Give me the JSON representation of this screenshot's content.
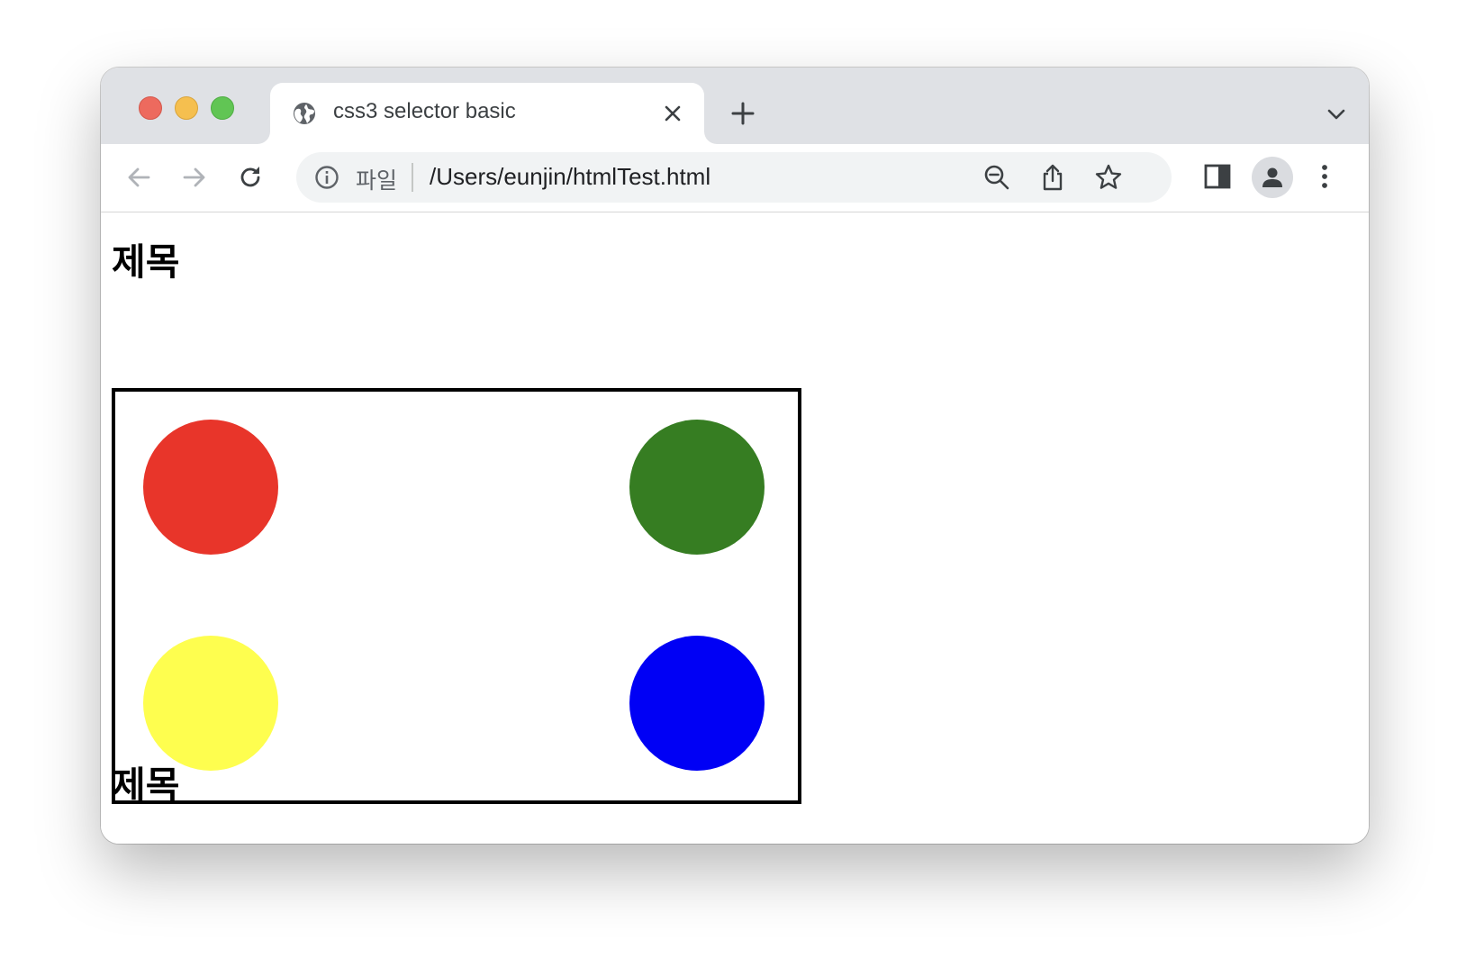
{
  "tab": {
    "title": "css3 selector basic"
  },
  "omnibox": {
    "scheme_label": "파일",
    "url": "/Users/eunjin/htmlTest.html"
  },
  "page": {
    "heading_top": "제목",
    "heading_bottom": "제목",
    "circles": [
      {
        "color": "#e8352a"
      },
      {
        "color": "#367d22"
      },
      {
        "color": "#fefe4f"
      },
      {
        "color": "#0000f5"
      }
    ]
  },
  "icons": {
    "close_red": "#ed6a5e",
    "minimize_yellow": "#f5bf4f",
    "zoom_green": "#61c554",
    "tab_favicon": "globe-icon",
    "tab_close": "close-icon",
    "new_tab": "plus-icon",
    "tab_search": "chevron-down-icon",
    "back": "arrow-left-icon",
    "forward": "arrow-right-icon",
    "reload": "reload-icon",
    "site_info": "info-icon",
    "zoom": "zoom-out-icon",
    "share": "share-icon",
    "bookmark": "star-icon",
    "side_panel": "side-panel-icon",
    "profile": "person-icon",
    "menu": "kebab-menu-icon"
  }
}
